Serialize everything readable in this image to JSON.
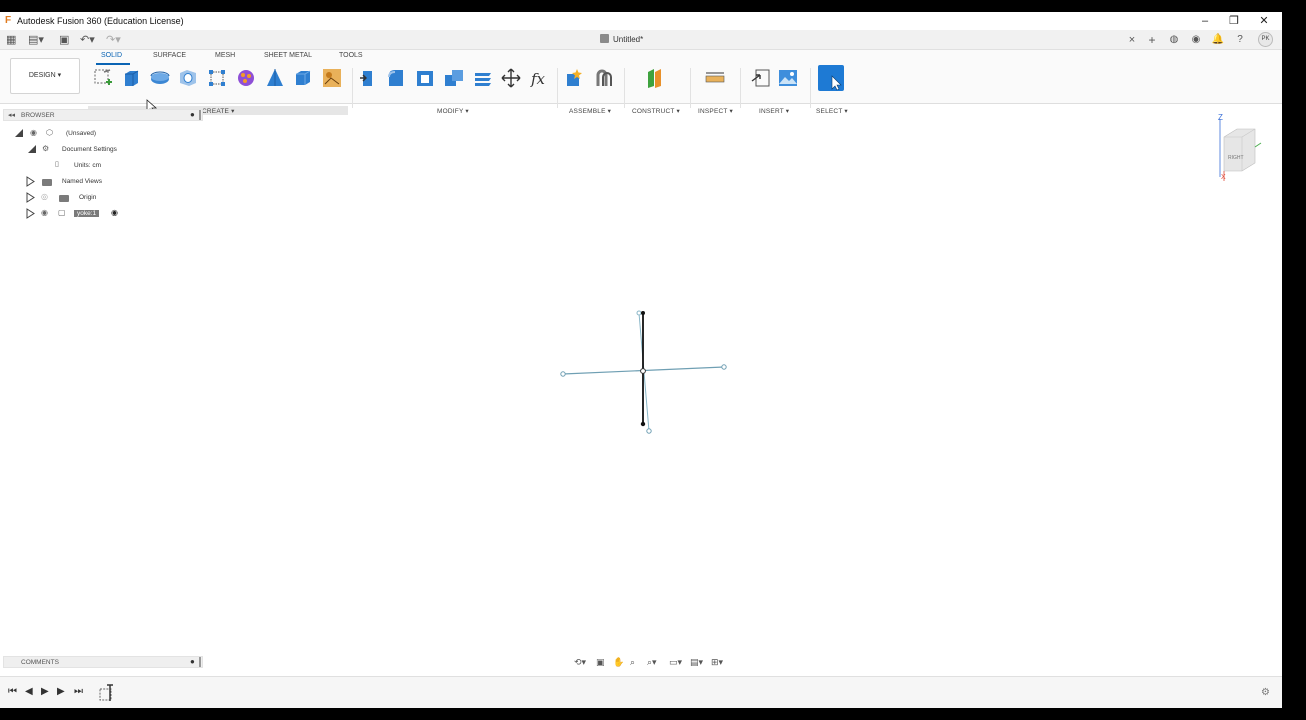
{
  "window": {
    "title": "Autodesk Fusion 360 (Education License)",
    "min_glyph": "–",
    "max_glyph": "❐",
    "close_glyph": "✕"
  },
  "document": {
    "tab_title": "Untitled*",
    "close_glyph": "×"
  },
  "user": {
    "initials": "PK"
  },
  "workspace": {
    "label": "DESIGN ▾"
  },
  "ribbon": {
    "tabs": [
      "SOLID",
      "SURFACE",
      "MESH",
      "SHEET METAL",
      "TOOLS"
    ],
    "groups": {
      "create": "CREATE ▾",
      "modify": "MODIFY ▾",
      "assemble": "ASSEMBLE ▾",
      "construct": "CONSTRUCT ▾",
      "inspect": "INSPECT ▾",
      "insert": "INSERT ▾",
      "select": "SELECT ▾"
    }
  },
  "browser": {
    "title": "BROWSER",
    "items": {
      "root": "(Unsaved)",
      "doc_settings": "Document Settings",
      "units": "Units: cm",
      "named_views": "Named Views",
      "origin": "Origin",
      "component": "yoke:1"
    }
  },
  "viewcube": {
    "face": "RIGHT",
    "axis_z": "Z",
    "axis_x": "X"
  },
  "comments": {
    "title": "COMMENTS"
  },
  "colors": {
    "accent": "#0a64b4",
    "sketch_line": "#6f9fb3",
    "sketch_constrained": "#111111"
  }
}
